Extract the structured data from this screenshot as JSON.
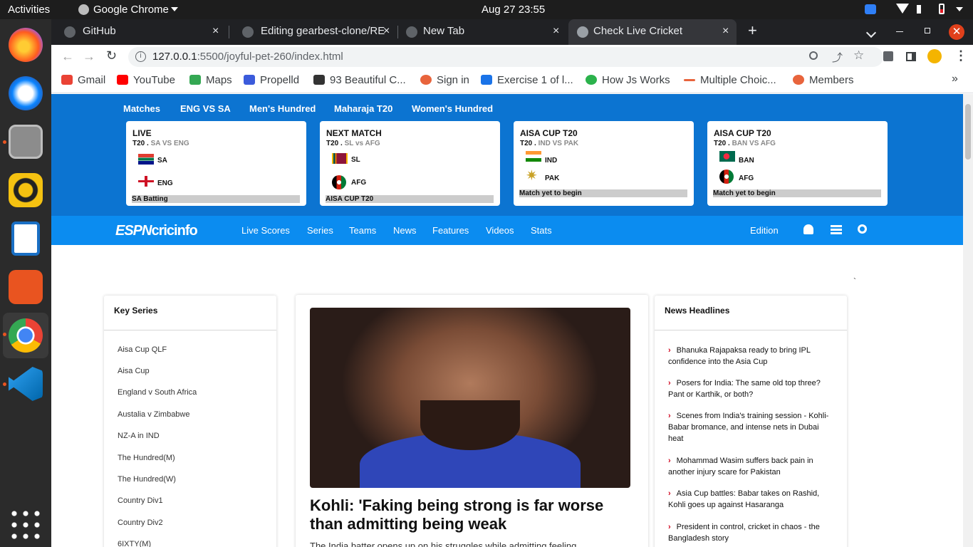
{
  "topbar": {
    "activities": "Activities",
    "app": "Google Chrome",
    "clock": "Aug 27  23:55"
  },
  "tabs": [
    {
      "title": "GitHub",
      "close": "×"
    },
    {
      "title": "Editing gearbest-clone/RE",
      "close": "×"
    },
    {
      "title": "New Tab",
      "close": "×"
    },
    {
      "title": "Check Live Cricket",
      "close": "×"
    }
  ],
  "newtab": "+",
  "url": {
    "host": "127.0.0.1",
    "rest": ":5500/joyful-pet-260/index.html"
  },
  "bookmarks": [
    {
      "label": "Gmail",
      "color": "#ea4335"
    },
    {
      "label": "YouTube",
      "color": "#ff0000"
    },
    {
      "label": "Maps",
      "color": "#34a853"
    },
    {
      "label": "Propelld",
      "color": "#3b5bdb"
    },
    {
      "label": "93 Beautiful C...",
      "color": "#333333"
    },
    {
      "label": "Sign in",
      "color": "#e8643c"
    },
    {
      "label": "Exercise 1 of l...",
      "color": "#1a73e8"
    },
    {
      "label": "How Js Works",
      "color": "#2bb24c"
    },
    {
      "label": "Multiple Choic...",
      "color": "#e8643c"
    },
    {
      "label": "Members",
      "color": "#e8643c"
    }
  ],
  "bm_more": "»",
  "topnav": [
    "Matches",
    "ENG VS SA",
    "Men's Hundred",
    "Maharaja T20",
    "Women's Hundred"
  ],
  "cards": [
    {
      "head": "LIVE",
      "fmt": "T20 .",
      "sub": "SA VS ENG",
      "t1": "SA",
      "t2": "ENG",
      "status": "SA Batting"
    },
    {
      "head": "NEXT MATCH",
      "fmt": "T20 .",
      "sub": "SL vs AFG",
      "t1": "SL",
      "t2": "AFG",
      "status": "AISA CUP T20"
    },
    {
      "head": "AISA CUP T20",
      "fmt": "T20 .",
      "sub": "IND VS PAK",
      "t1": "IND",
      "t2": "PAK",
      "status": "Match yet to begin"
    },
    {
      "head": "AISA CUP T20",
      "fmt": "T20 .",
      "sub": "BAN VS AFG",
      "t1": "BAN",
      "t2": "AFG",
      "status": "Match yet to begin"
    }
  ],
  "brand": {
    "espn": "ESPN",
    "cric": "cricinfo"
  },
  "nav": [
    "Live Scores",
    "Series",
    "Teams",
    "News",
    "Features",
    "Videos",
    "Stats"
  ],
  "edition": "Edition",
  "backtick": "`",
  "key_series": {
    "title": "Key Series",
    "items": [
      "Aisa Cup QLF",
      "Aisa Cup",
      "England v South Africa",
      "Austalia v Zimbabwe",
      "NZ-A in IND",
      "The Hundred(M)",
      "The Hundred(W)",
      "Country Div1",
      "Country Div2",
      "6IXTY(M)"
    ]
  },
  "story": {
    "headline": "Kohli: 'Faking being strong is far worse than admitting being weak",
    "teaser": "The India batter opens up on his struggles while admitting feeling"
  },
  "news": {
    "title": "News Headlines",
    "items": [
      "Bhanuka Rajapaksa ready to bring IPL confidence into the Asia Cup",
      "Posers for India: The same old top three? Pant or Karthik, or both?",
      "Scenes from India's training session - Kohli-Babar bromance, and intense nets in Dubai heat",
      "Mohammad Wasim suffers back pain in another injury scare for Pakistan",
      "Asia Cup battles: Babar takes on Rashid, Kohli goes up against Hasaranga",
      "President in control, cricket in chaos - the Bangladesh story"
    ]
  }
}
